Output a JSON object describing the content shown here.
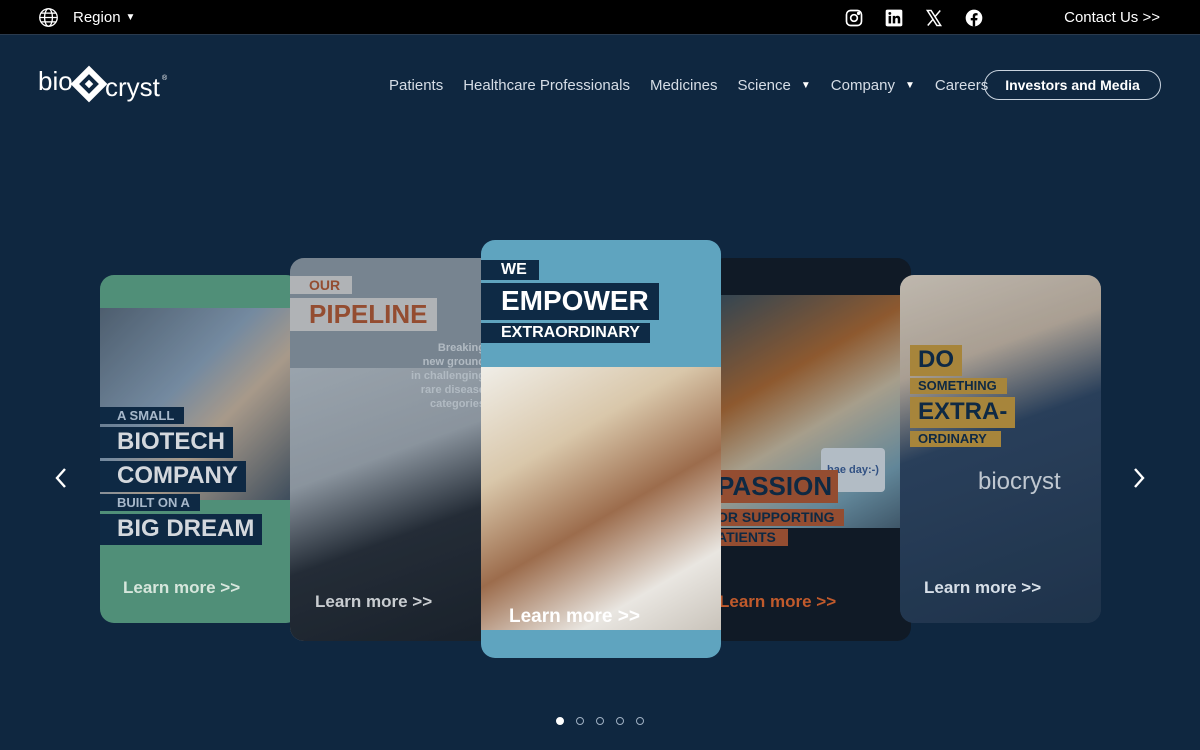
{
  "topbar": {
    "region_label": "Region",
    "region_icon": "globe-icon",
    "socials": [
      "instagram-icon",
      "linkedin-icon",
      "x-icon",
      "facebook-icon"
    ],
    "contact_label": "Contact Us >>"
  },
  "header": {
    "logo_text": "biocryst",
    "nav": [
      {
        "label": "Patients",
        "dropdown": false
      },
      {
        "label": "Healthcare Professionals",
        "dropdown": false
      },
      {
        "label": "Medicines",
        "dropdown": false
      },
      {
        "label": "Science",
        "dropdown": true
      },
      {
        "label": "Company",
        "dropdown": true
      },
      {
        "label": "Careers",
        "dropdown": false
      }
    ],
    "investors_label": "Investors and Media"
  },
  "carousel": {
    "cards": [
      {
        "lines": [
          "A SMALL",
          "BIOTECH",
          "COMPANY",
          "BUILT ON A",
          "BIG DREAM"
        ],
        "learn_more": "Learn more >>"
      },
      {
        "lines": [
          "OUR",
          "PIPELINE"
        ],
        "caption": [
          "Breaking",
          "new ground",
          "in challenging",
          "rare disease",
          "categories"
        ],
        "learn_more": "Learn more >>"
      },
      {
        "lines": [
          "WE",
          "EMPOWER",
          "EXTRAORDINARY"
        ],
        "learn_more": "Learn more >>"
      },
      {
        "lines": [
          "PASSION",
          "OR SUPPORTING",
          "ATIENTS"
        ],
        "sign_text": "bae day:-)",
        "learn_more": "Learn more >>"
      },
      {
        "lines": [
          "DO",
          "SOMETHING",
          "EXTRA-",
          "ORDINARY"
        ],
        "hoodie_text": "biocryst",
        "learn_more": "Learn more >>"
      }
    ],
    "active_index": 0,
    "slide_count": 5
  },
  "colors": {
    "background": "#0f2740",
    "topbar": "#000000",
    "card_green": "#5fa684",
    "card_blue": "#5fa4bf",
    "orange": "#c05a2c",
    "gold": "#c99a3a",
    "navy_label": "#0e2a45"
  }
}
